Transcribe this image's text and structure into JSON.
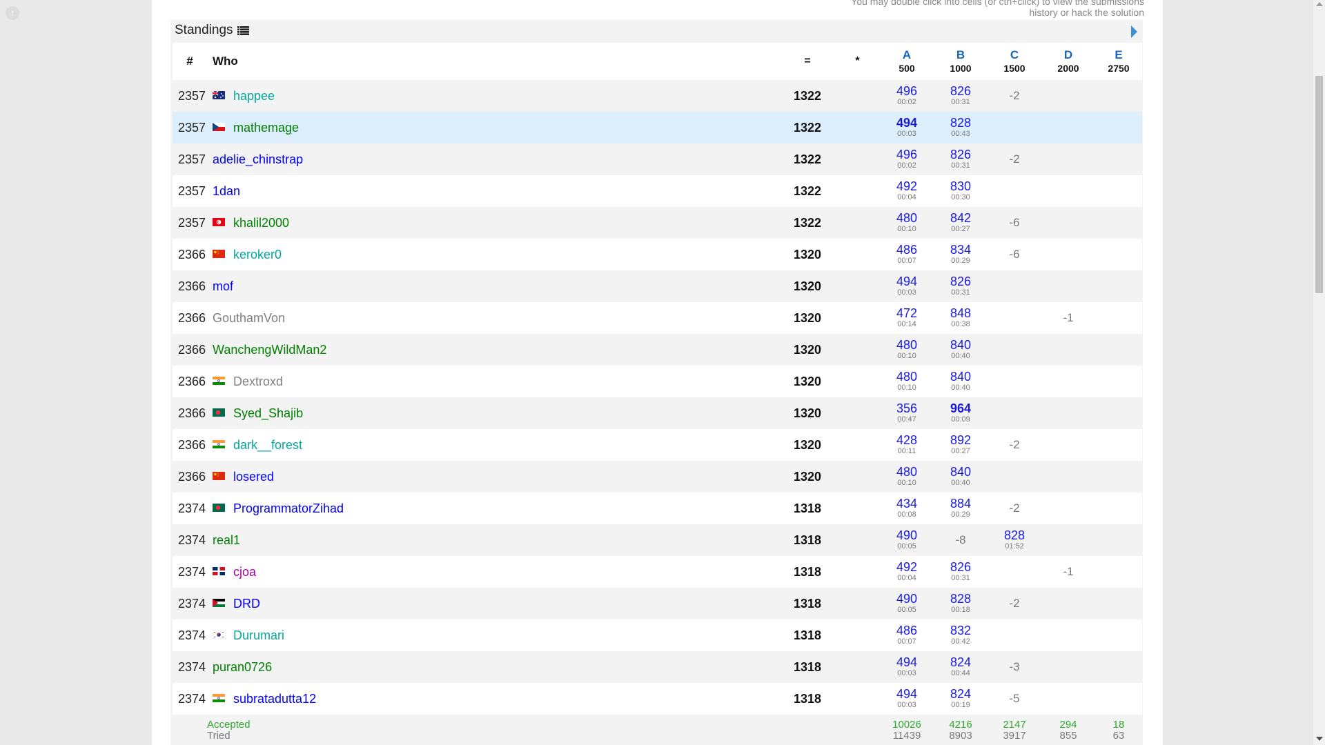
{
  "hint": {
    "line1": "You may double click into cells (or ctrl+click) to view the submissions",
    "line2": "history or hack the solution"
  },
  "standings": {
    "title": "Standings",
    "icons": {
      "list": "list-icon",
      "next": "next-arrow-icon",
      "back": "arrow-up-circle-icon"
    }
  },
  "header": {
    "rank": "#",
    "who": "Who",
    "points": "=",
    "penalty": "*",
    "problems": [
      {
        "letter": "A",
        "points": "500"
      },
      {
        "letter": "B",
        "points": "1000"
      },
      {
        "letter": "C",
        "points": "1500"
      },
      {
        "letter": "D",
        "points": "2000"
      },
      {
        "letter": "E",
        "points": "2750"
      }
    ]
  },
  "rows": [
    {
      "rank": "2357",
      "flag": "australia",
      "handle": "happee",
      "color": "cyan",
      "points": "1322",
      "cells": [
        {
          "v": "496",
          "t": "00:02"
        },
        {
          "v": "826",
          "t": "00:31"
        },
        {
          "r": "-2"
        },
        {},
        {}
      ]
    },
    {
      "rank": "2357",
      "flag": "czech",
      "handle": "mathemage",
      "color": "green",
      "points": "1322",
      "cells": [
        {
          "v": "494",
          "t": "00:03",
          "first": true
        },
        {
          "v": "828",
          "t": "00:43"
        },
        {},
        {},
        {}
      ]
    },
    {
      "rank": "2357",
      "flag": "",
      "handle": "adelie_chinstrap",
      "color": "blue",
      "points": "1322",
      "cells": [
        {
          "v": "496",
          "t": "00:02"
        },
        {
          "v": "826",
          "t": "00:31"
        },
        {
          "r": "-2"
        },
        {},
        {}
      ]
    },
    {
      "rank": "2357",
      "flag": "",
      "handle": "1dan",
      "color": "blue",
      "points": "1322",
      "cells": [
        {
          "v": "492",
          "t": "00:04"
        },
        {
          "v": "830",
          "t": "00:30"
        },
        {},
        {},
        {}
      ]
    },
    {
      "rank": "2357",
      "flag": "tunisia",
      "handle": "khalil2000",
      "color": "green",
      "points": "1322",
      "cells": [
        {
          "v": "480",
          "t": "00:10"
        },
        {
          "v": "842",
          "t": "00:27"
        },
        {
          "r": "-6"
        },
        {},
        {}
      ]
    },
    {
      "rank": "2366",
      "flag": "china",
      "handle": "keroker0",
      "color": "cyan",
      "points": "1320",
      "cells": [
        {
          "v": "486",
          "t": "00:07"
        },
        {
          "v": "834",
          "t": "00:29"
        },
        {
          "r": "-6"
        },
        {},
        {}
      ]
    },
    {
      "rank": "2366",
      "flag": "",
      "handle": "mof",
      "color": "blue",
      "points": "1320",
      "cells": [
        {
          "v": "494",
          "t": "00:03"
        },
        {
          "v": "826",
          "t": "00:31"
        },
        {},
        {},
        {}
      ]
    },
    {
      "rank": "2366",
      "flag": "",
      "handle": "GouthamVon",
      "color": "gray",
      "points": "1320",
      "cells": [
        {
          "v": "472",
          "t": "00:14"
        },
        {
          "v": "848",
          "t": "00:38"
        },
        {},
        {
          "r": "-1"
        },
        {}
      ]
    },
    {
      "rank": "2366",
      "flag": "",
      "handle": "WanchengWildMan2",
      "color": "green",
      "points": "1320",
      "cells": [
        {
          "v": "480",
          "t": "00:10"
        },
        {
          "v": "840",
          "t": "00:40"
        },
        {},
        {},
        {}
      ]
    },
    {
      "rank": "2366",
      "flag": "india",
      "handle": "Dextroxd",
      "color": "gray",
      "points": "1320",
      "cells": [
        {
          "v": "480",
          "t": "00:10"
        },
        {
          "v": "840",
          "t": "00:40"
        },
        {},
        {},
        {}
      ]
    },
    {
      "rank": "2366",
      "flag": "bangladesh",
      "handle": "Syed_Shajib",
      "color": "green",
      "points": "1320",
      "cells": [
        {
          "v": "356",
          "t": "00:47"
        },
        {
          "v": "964",
          "t": "00:09",
          "first": true
        },
        {},
        {},
        {}
      ]
    },
    {
      "rank": "2366",
      "flag": "india",
      "handle": "dark__forest",
      "color": "cyan",
      "points": "1320",
      "cells": [
        {
          "v": "428",
          "t": "00:11"
        },
        {
          "v": "892",
          "t": "00:27"
        },
        {
          "r": "-2"
        },
        {},
        {}
      ]
    },
    {
      "rank": "2366",
      "flag": "china",
      "handle": "losered",
      "color": "blue",
      "points": "1320",
      "cells": [
        {
          "v": "480",
          "t": "00:10"
        },
        {
          "v": "840",
          "t": "00:40"
        },
        {},
        {},
        {}
      ]
    },
    {
      "rank": "2374",
      "flag": "bangladesh",
      "handle": "ProgrammatorZihad",
      "color": "blue",
      "points": "1318",
      "cells": [
        {
          "v": "434",
          "t": "00:08"
        },
        {
          "v": "884",
          "t": "00:29"
        },
        {
          "r": "-2"
        },
        {},
        {}
      ]
    },
    {
      "rank": "2374",
      "flag": "",
      "handle": "real1",
      "color": "green",
      "points": "1318",
      "cells": [
        {
          "v": "490",
          "t": "00:05"
        },
        {
          "r": "-8"
        },
        {
          "v": "828",
          "t": "01:52"
        },
        {},
        {}
      ]
    },
    {
      "rank": "2374",
      "flag": "dominican",
      "handle": "cjoa",
      "color": "violet",
      "points": "1318",
      "cells": [
        {
          "v": "492",
          "t": "00:04"
        },
        {
          "v": "826",
          "t": "00:31"
        },
        {},
        {
          "r": "-1"
        },
        {}
      ]
    },
    {
      "rank": "2374",
      "flag": "jordan",
      "handle": "DRD",
      "color": "blue",
      "points": "1318",
      "cells": [
        {
          "v": "490",
          "t": "00:05"
        },
        {
          "v": "828",
          "t": "00:18"
        },
        {
          "r": "-2"
        },
        {},
        {}
      ]
    },
    {
      "rank": "2374",
      "flag": "korea",
      "handle": "Durumari",
      "color": "cyan",
      "points": "1318",
      "cells": [
        {
          "v": "486",
          "t": "00:07"
        },
        {
          "v": "832",
          "t": "00:42"
        },
        {},
        {},
        {}
      ]
    },
    {
      "rank": "2374",
      "flag": "",
      "handle": "puran0726",
      "color": "green",
      "points": "1318",
      "cells": [
        {
          "v": "494",
          "t": "00:03"
        },
        {
          "v": "824",
          "t": "00:44"
        },
        {
          "r": "-3"
        },
        {},
        {}
      ]
    },
    {
      "rank": "2374",
      "flag": "india",
      "handle": "subratadutta12",
      "color": "blue",
      "points": "1318",
      "cells": [
        {
          "v": "494",
          "t": "00:03"
        },
        {
          "v": "824",
          "t": "00:19"
        },
        {
          "r": "-5"
        },
        {},
        {}
      ]
    }
  ],
  "highlight_row": 1,
  "stats": {
    "accepted_label": "Accepted",
    "tried_label": "Tried",
    "problems": [
      {
        "accepted": "10026",
        "tried": "11439"
      },
      {
        "accepted": "4216",
        "tried": "8903"
      },
      {
        "accepted": "2147",
        "tried": "3917"
      },
      {
        "accepted": "294",
        "tried": "855"
      },
      {
        "accepted": "18",
        "tried": "63"
      }
    ]
  },
  "colors": {
    "green": "#008000",
    "cyan": "#03a89e",
    "blue": "#0000ff",
    "gray": "#808080",
    "violet": "#aa00aa",
    "accepted": "#1a1adb",
    "header_link": "#1565c0"
  }
}
